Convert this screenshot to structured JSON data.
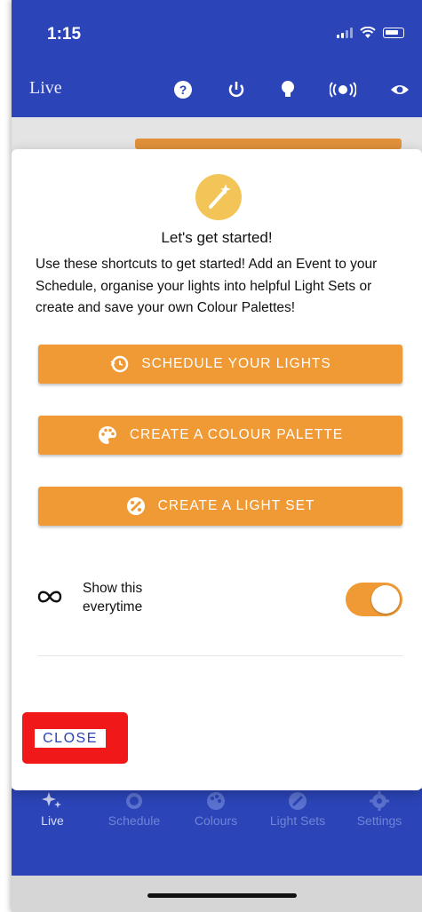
{
  "status_bar": {
    "time": "1:15"
  },
  "app_bar": {
    "title": "Live",
    "icons": [
      "help-icon",
      "power-icon",
      "bulb-icon",
      "broadcast-icon",
      "eye-icon"
    ]
  },
  "dialog": {
    "title": "Let's get started!",
    "body": "Use these shortcuts to get started! Add an Event to your Schedule, organise your lights into helpful Light Sets or create and save your own Colour Palettes!",
    "buttons": [
      {
        "label": "SCHEDULE YOUR LIGHTS",
        "icon": "schedule-icon"
      },
      {
        "label": "CREATE A COLOUR PALETTE",
        "icon": "palette-icon"
      },
      {
        "label": "CREATE A LIGHT SET",
        "icon": "light-set-icon"
      }
    ],
    "toggle": {
      "label": "Show this everytime",
      "on": true
    },
    "close_label": "CLOSE"
  },
  "bottom_nav": {
    "items": [
      {
        "label": "Live",
        "icon": "sparkle-icon",
        "active": true
      },
      {
        "label": "Schedule",
        "icon": "schedule-icon",
        "active": false
      },
      {
        "label": "Colours",
        "icon": "palette-icon",
        "active": false
      },
      {
        "label": "Light Sets",
        "icon": "light-set-icon",
        "active": false
      },
      {
        "label": "Settings",
        "icon": "gear-icon",
        "active": false
      }
    ]
  },
  "colors": {
    "primary": "#2b45b8",
    "accent": "#ef9a35",
    "wand_bg": "#f3c457",
    "highlight": "#f01818"
  }
}
